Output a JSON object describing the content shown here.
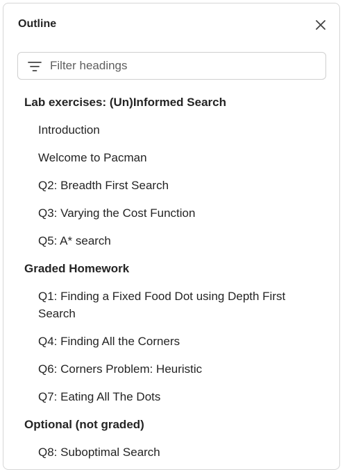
{
  "panel": {
    "title": "Outline",
    "close_icon": "close-icon"
  },
  "filter": {
    "icon": "filter-icon",
    "placeholder": "Filter headings",
    "value": ""
  },
  "outline": {
    "sections": [
      {
        "heading": "Lab exercises: (Un)Informed Search",
        "items": [
          "Introduction",
          "Welcome to Pacman",
          "Q2: Breadth First Search",
          "Q3: Varying the Cost Function",
          "Q5: A* search"
        ]
      },
      {
        "heading": "Graded Homework",
        "items": [
          "Q1: Finding a Fixed Food Dot using Depth First Search",
          "Q4: Finding All the Corners",
          "Q6: Corners Problem: Heuristic",
          "Q7: Eating All The Dots"
        ]
      },
      {
        "heading": "Optional (not graded)",
        "items": [
          "Q8: Suboptimal Search"
        ]
      }
    ]
  }
}
